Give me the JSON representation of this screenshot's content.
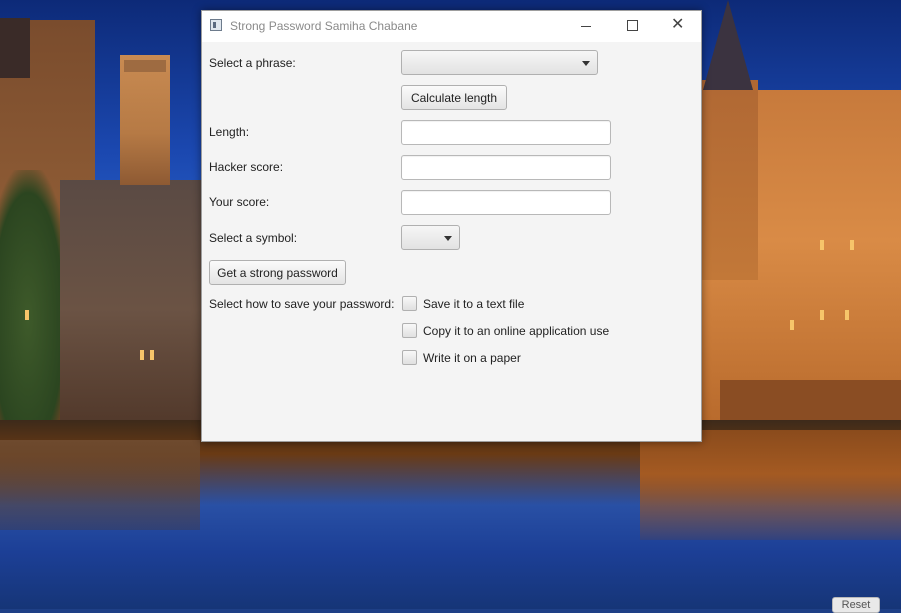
{
  "window": {
    "title": "Strong Password Samiha Chabane"
  },
  "form": {
    "phrase_label": "Select a phrase:",
    "phrase_selected": "",
    "calculate_button": "Calculate length",
    "length_label": "Length:",
    "length_value": "",
    "hacker_label": "Hacker score:",
    "hacker_value": "",
    "your_score_label": "Your score:",
    "your_score_value": "",
    "symbol_label": "Select a symbol:",
    "symbol_selected": "",
    "strong_button": "Get a strong password",
    "save_label": "Select how to save your password:",
    "save_options": [
      {
        "label": "Save it to a text file",
        "checked": false
      },
      {
        "label": "Copy it to an online application use",
        "checked": false
      },
      {
        "label": "Write it on a paper",
        "checked": false
      }
    ]
  },
  "desktop": {
    "corner_button": "Reset"
  }
}
